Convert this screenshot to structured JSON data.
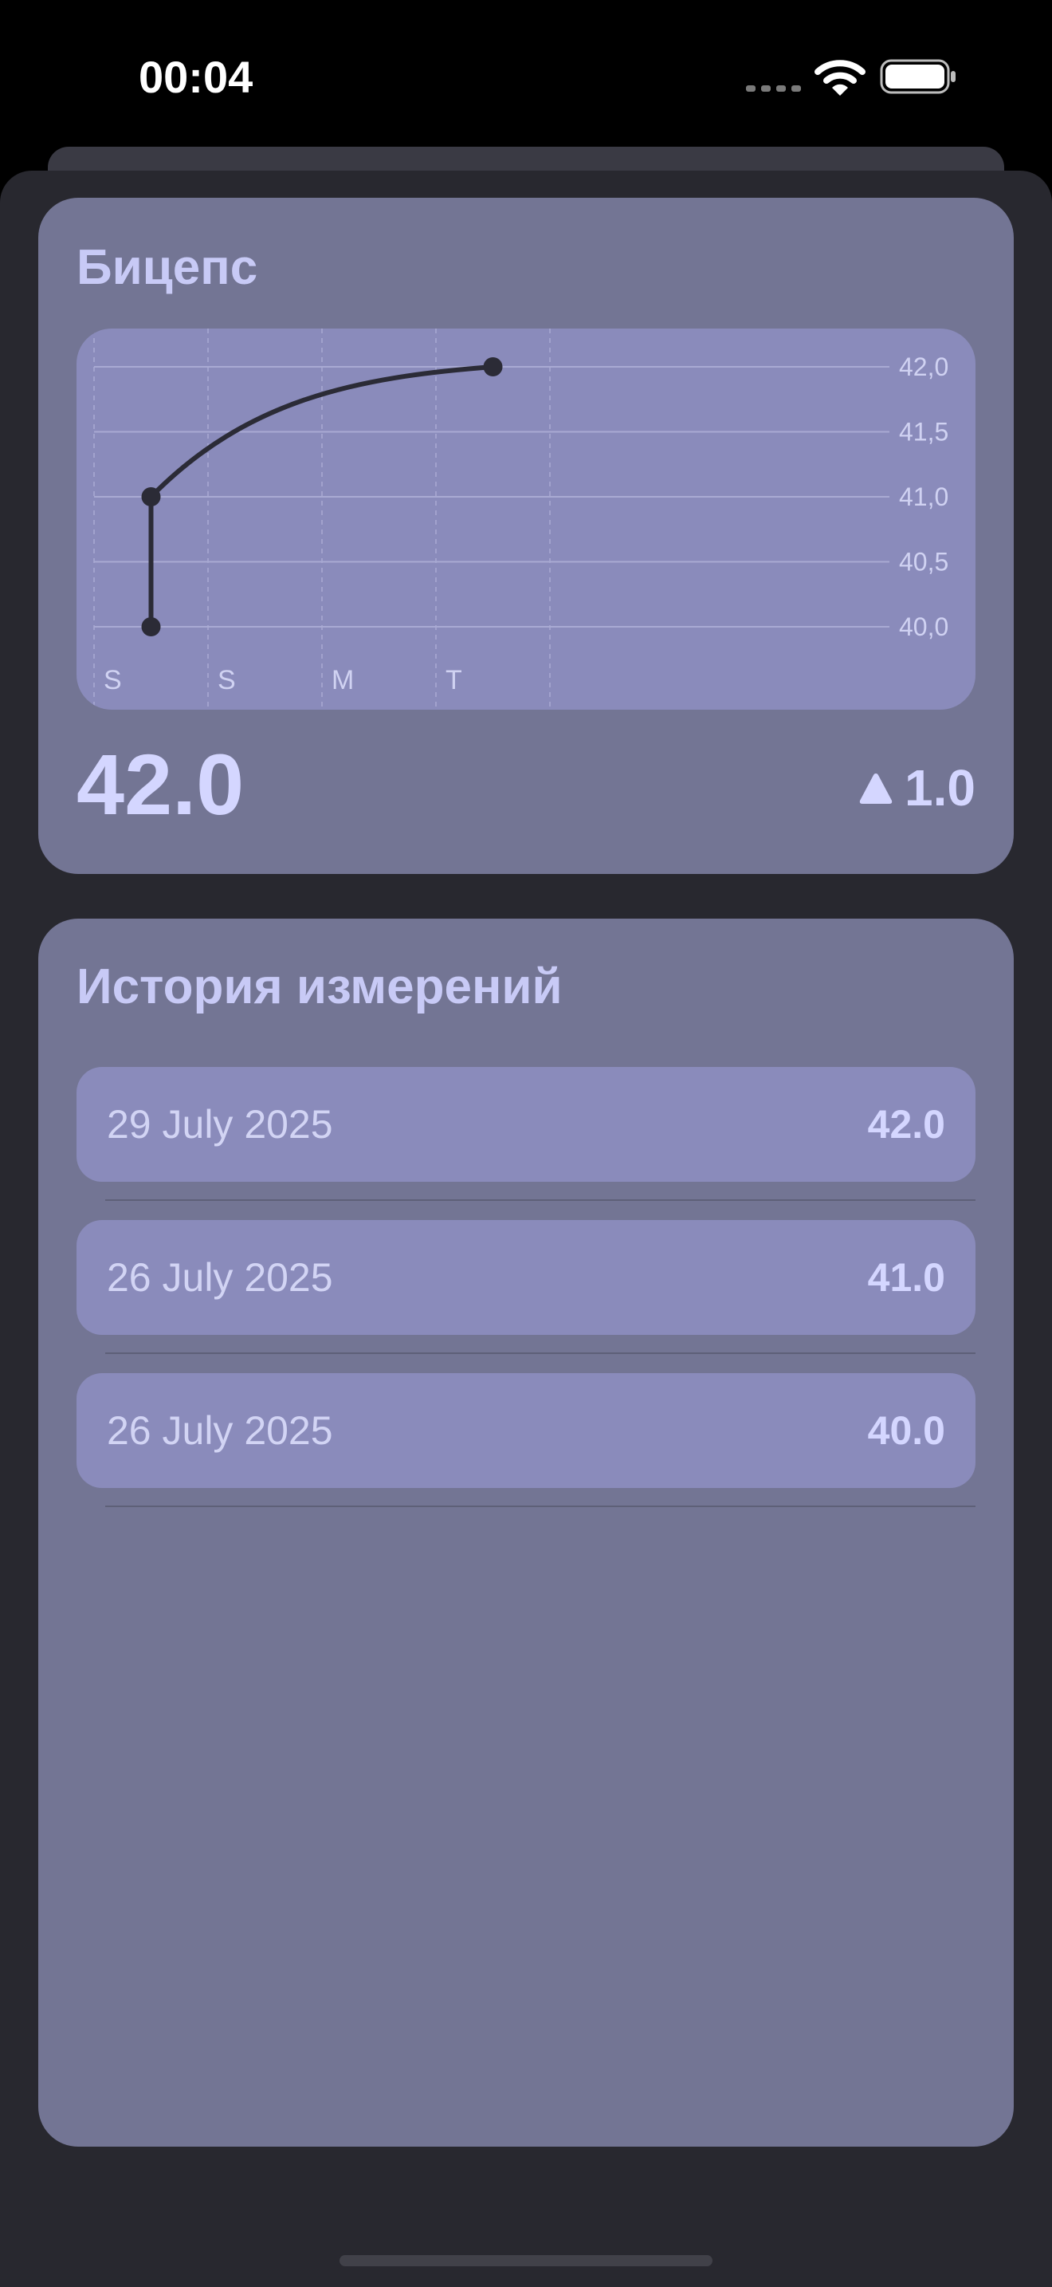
{
  "status_bar": {
    "time": "00:04",
    "icons": [
      "cellular-dots-icon",
      "wifi-icon",
      "battery-icon"
    ]
  },
  "measurement_card": {
    "title": "Бицепс",
    "current_value": "42.0",
    "change": "1.0",
    "change_icon": "triangle-up-icon"
  },
  "chart_data": {
    "type": "line",
    "x_tick_labels": [
      "S",
      "S",
      "M",
      "T"
    ],
    "y_tick_labels": [
      "42,0",
      "41,5",
      "41,0",
      "40,5",
      "40,0"
    ],
    "ylim": [
      40.0,
      42.0
    ],
    "grid": true,
    "series": [
      {
        "x": [
          0.5,
          0.5,
          3.5
        ],
        "y": [
          40.0,
          41.0,
          42.0
        ]
      }
    ]
  },
  "history_card": {
    "title": "История измерений",
    "rows": [
      {
        "date": "29 July 2025",
        "value": "42.0"
      },
      {
        "date": "26 July 2025",
        "value": "41.0"
      },
      {
        "date": "26 July 2025",
        "value": "40.0"
      }
    ]
  },
  "colors": {
    "background": "#28282f",
    "card": "#737594",
    "chart_fill": "#8a8bbb",
    "accent_text": "#c8caf6",
    "line": "#2b2b36"
  }
}
